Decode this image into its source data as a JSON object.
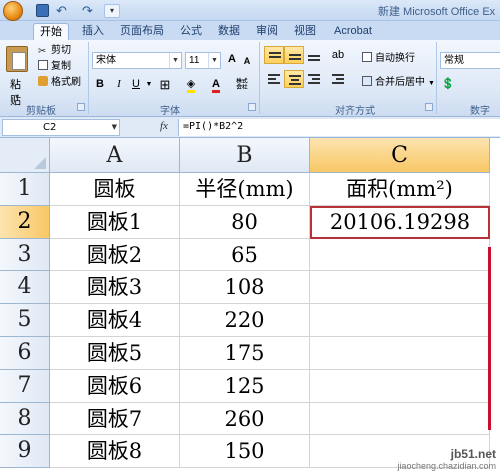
{
  "window": {
    "title": "新建 Microsoft Office Ex"
  },
  "tabs": [
    "开始",
    "插入",
    "页面布局",
    "公式",
    "数据",
    "审阅",
    "视图",
    "Acrobat"
  ],
  "ribbon": {
    "clipboard": {
      "paste": "粘贴",
      "cut": "剪切",
      "copy": "复制",
      "format_painter": "格式刷",
      "label": "剪贴板"
    },
    "font": {
      "name": "宋体",
      "size": "11",
      "grow": "A",
      "shrink": "A",
      "bold": "B",
      "italic": "I",
      "underline": "U",
      "font_color_glyph": "A",
      "label": "字体"
    },
    "alignment": {
      "wrap_text": "自动换行",
      "merge_center": "合并后居中",
      "label": "对齐方式"
    },
    "number": {
      "format": "常规",
      "label": "数字"
    }
  },
  "formula_bar": {
    "name_box": "C2",
    "fx": "fx",
    "formula": "=PI()*B2^2"
  },
  "grid": {
    "columns": [
      "A",
      "B",
      "C"
    ],
    "selected_column": "C",
    "selected_row": "2",
    "rows": [
      {
        "num": "1",
        "a": "圆板",
        "b": "半径(mm)",
        "c": "面积(mm²)"
      },
      {
        "num": "2",
        "a": "圆板1",
        "b": "80",
        "c": "20106.19298"
      },
      {
        "num": "3",
        "a": "圆板2",
        "b": "65",
        "c": ""
      },
      {
        "num": "4",
        "a": "圆板3",
        "b": "108",
        "c": ""
      },
      {
        "num": "5",
        "a": "圆板4",
        "b": "220",
        "c": ""
      },
      {
        "num": "6",
        "a": "圆板5",
        "b": "175",
        "c": ""
      },
      {
        "num": "7",
        "a": "圆板6",
        "b": "125",
        "c": ""
      },
      {
        "num": "8",
        "a": "圆板7",
        "b": "260",
        "c": ""
      },
      {
        "num": "9",
        "a": "圆板8",
        "b": "150",
        "c": ""
      }
    ]
  },
  "watermark": {
    "main": "jb51.net",
    "sub": "jiaocheng.chazidian.com"
  },
  "colors": {
    "selection_border": "#b7323a",
    "header_selected": "#f8c765",
    "annotation_line": "#c8102e"
  }
}
